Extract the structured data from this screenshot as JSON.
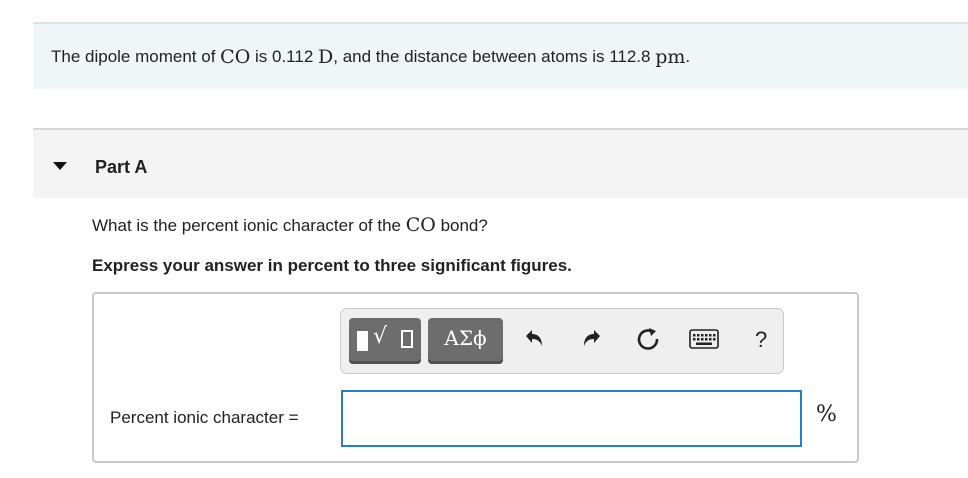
{
  "prompt": {
    "prefix": "The dipole moment of ",
    "molecule": "CO",
    "mid1": " is 0.112 ",
    "dipole_unit": "D",
    "mid2": ", and the distance between atoms is 112.8 ",
    "distance_unit": "pm",
    "suffix": "."
  },
  "part": {
    "title": "Part A"
  },
  "question": {
    "prefix": "What is the percent ionic character of the ",
    "molecule": "CO",
    "suffix": " bond?"
  },
  "instruction": "Express your answer in percent to three significant figures.",
  "toolbar": {
    "greek_label": "ΑΣϕ",
    "help_label": "?",
    "icons": [
      "templates-icon",
      "greek-letters-icon",
      "undo-icon",
      "redo-icon",
      "reset-icon",
      "keyboard-icon",
      "help-icon"
    ]
  },
  "answer": {
    "label": "Percent ionic character =",
    "value": "",
    "unit": "%"
  },
  "colors": {
    "prompt_bg": "#eef6f8",
    "input_border": "#2c7fb8",
    "toolbar_button": "#6d6d6d"
  }
}
